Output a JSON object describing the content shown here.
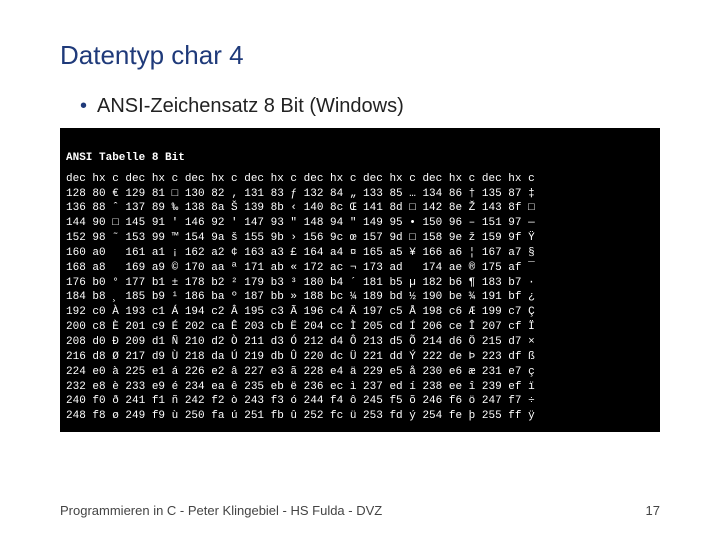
{
  "title": "Datentyp char 4",
  "bullet": "ANSI-Zeichensatz 8 Bit (Windows)",
  "console_header": "ANSI Tabelle 8 Bit",
  "table": {
    "headers": [
      "dec",
      "hx",
      "c",
      "dec",
      "hx",
      "c",
      "dec",
      "hx",
      "c",
      "dec",
      "hx",
      "c",
      "dec",
      "hx",
      "c",
      "dec",
      "hx",
      "c",
      "dec",
      "hx",
      "c",
      "dec",
      "hx",
      "c"
    ],
    "rows": [
      [
        "128",
        "80",
        "€",
        "129",
        "81",
        "□",
        "130",
        "82",
        "‚",
        "131",
        "83",
        "ƒ",
        "132",
        "84",
        "„",
        "133",
        "85",
        "…",
        "134",
        "86",
        "†",
        "135",
        "87",
        "‡"
      ],
      [
        "136",
        "88",
        "ˆ",
        "137",
        "89",
        "‰",
        "138",
        "8a",
        "Š",
        "139",
        "8b",
        "‹",
        "140",
        "8c",
        "Œ",
        "141",
        "8d",
        "□",
        "142",
        "8e",
        "Ž",
        "143",
        "8f",
        "□"
      ],
      [
        "144",
        "90",
        "□",
        "145",
        "91",
        "'",
        "146",
        "92",
        "'",
        "147",
        "93",
        "\"",
        "148",
        "94",
        "\"",
        "149",
        "95",
        "•",
        "150",
        "96",
        "–",
        "151",
        "97",
        "—"
      ],
      [
        "152",
        "98",
        "˜",
        "153",
        "99",
        "™",
        "154",
        "9a",
        "š",
        "155",
        "9b",
        "›",
        "156",
        "9c",
        "œ",
        "157",
        "9d",
        "□",
        "158",
        "9e",
        "ž",
        "159",
        "9f",
        "Ÿ"
      ],
      [
        "160",
        "a0",
        " ",
        "161",
        "a1",
        "¡",
        "162",
        "a2",
        "¢",
        "163",
        "a3",
        "£",
        "164",
        "a4",
        "¤",
        "165",
        "a5",
        "¥",
        "166",
        "a6",
        "¦",
        "167",
        "a7",
        "§"
      ],
      [
        "168",
        "a8",
        " ",
        "169",
        "a9",
        "©",
        "170",
        "aa",
        "ª",
        "171",
        "ab",
        "«",
        "172",
        "ac",
        "¬",
        "173",
        "ad",
        " ",
        "174",
        "ae",
        "®",
        "175",
        "af",
        "¯"
      ],
      [
        "176",
        "b0",
        "°",
        "177",
        "b1",
        "±",
        "178",
        "b2",
        "²",
        "179",
        "b3",
        "³",
        "180",
        "b4",
        "´",
        "181",
        "b5",
        "µ",
        "182",
        "b6",
        "¶",
        "183",
        "b7",
        "·"
      ],
      [
        "184",
        "b8",
        "¸",
        "185",
        "b9",
        "¹",
        "186",
        "ba",
        "º",
        "187",
        "bb",
        "»",
        "188",
        "bc",
        "¼",
        "189",
        "bd",
        "½",
        "190",
        "be",
        "¾",
        "191",
        "bf",
        "¿"
      ],
      [
        "192",
        "c0",
        "À",
        "193",
        "c1",
        "Á",
        "194",
        "c2",
        "Â",
        "195",
        "c3",
        "Ã",
        "196",
        "c4",
        "Ä",
        "197",
        "c5",
        "Å",
        "198",
        "c6",
        "Æ",
        "199",
        "c7",
        "Ç"
      ],
      [
        "200",
        "c8",
        "È",
        "201",
        "c9",
        "É",
        "202",
        "ca",
        "Ê",
        "203",
        "cb",
        "Ë",
        "204",
        "cc",
        "Ì",
        "205",
        "cd",
        "Í",
        "206",
        "ce",
        "Î",
        "207",
        "cf",
        "Ï"
      ],
      [
        "208",
        "d0",
        "Ð",
        "209",
        "d1",
        "Ñ",
        "210",
        "d2",
        "Ò",
        "211",
        "d3",
        "Ó",
        "212",
        "d4",
        "Ô",
        "213",
        "d5",
        "Õ",
        "214",
        "d6",
        "Ö",
        "215",
        "d7",
        "×"
      ],
      [
        "216",
        "d8",
        "Ø",
        "217",
        "d9",
        "Ù",
        "218",
        "da",
        "Ú",
        "219",
        "db",
        "Û",
        "220",
        "dc",
        "Ü",
        "221",
        "dd",
        "Ý",
        "222",
        "de",
        "Þ",
        "223",
        "df",
        "ß"
      ],
      [
        "224",
        "e0",
        "à",
        "225",
        "e1",
        "á",
        "226",
        "e2",
        "â",
        "227",
        "e3",
        "ã",
        "228",
        "e4",
        "ä",
        "229",
        "e5",
        "å",
        "230",
        "e6",
        "æ",
        "231",
        "e7",
        "ç"
      ],
      [
        "232",
        "e8",
        "è",
        "233",
        "e9",
        "é",
        "234",
        "ea",
        "ê",
        "235",
        "eb",
        "ë",
        "236",
        "ec",
        "ì",
        "237",
        "ed",
        "í",
        "238",
        "ee",
        "î",
        "239",
        "ef",
        "ï"
      ],
      [
        "240",
        "f0",
        "ð",
        "241",
        "f1",
        "ñ",
        "242",
        "f2",
        "ò",
        "243",
        "f3",
        "ó",
        "244",
        "f4",
        "ô",
        "245",
        "f5",
        "õ",
        "246",
        "f6",
        "ö",
        "247",
        "f7",
        "÷"
      ],
      [
        "248",
        "f8",
        "ø",
        "249",
        "f9",
        "ù",
        "250",
        "fa",
        "ú",
        "251",
        "fb",
        "û",
        "252",
        "fc",
        "ü",
        "253",
        "fd",
        "ý",
        "254",
        "fe",
        "þ",
        "255",
        "ff",
        "ÿ"
      ]
    ]
  },
  "footer_text": "Programmieren in C - Peter Klingebiel - HS Fulda - DVZ",
  "page_number": "17"
}
